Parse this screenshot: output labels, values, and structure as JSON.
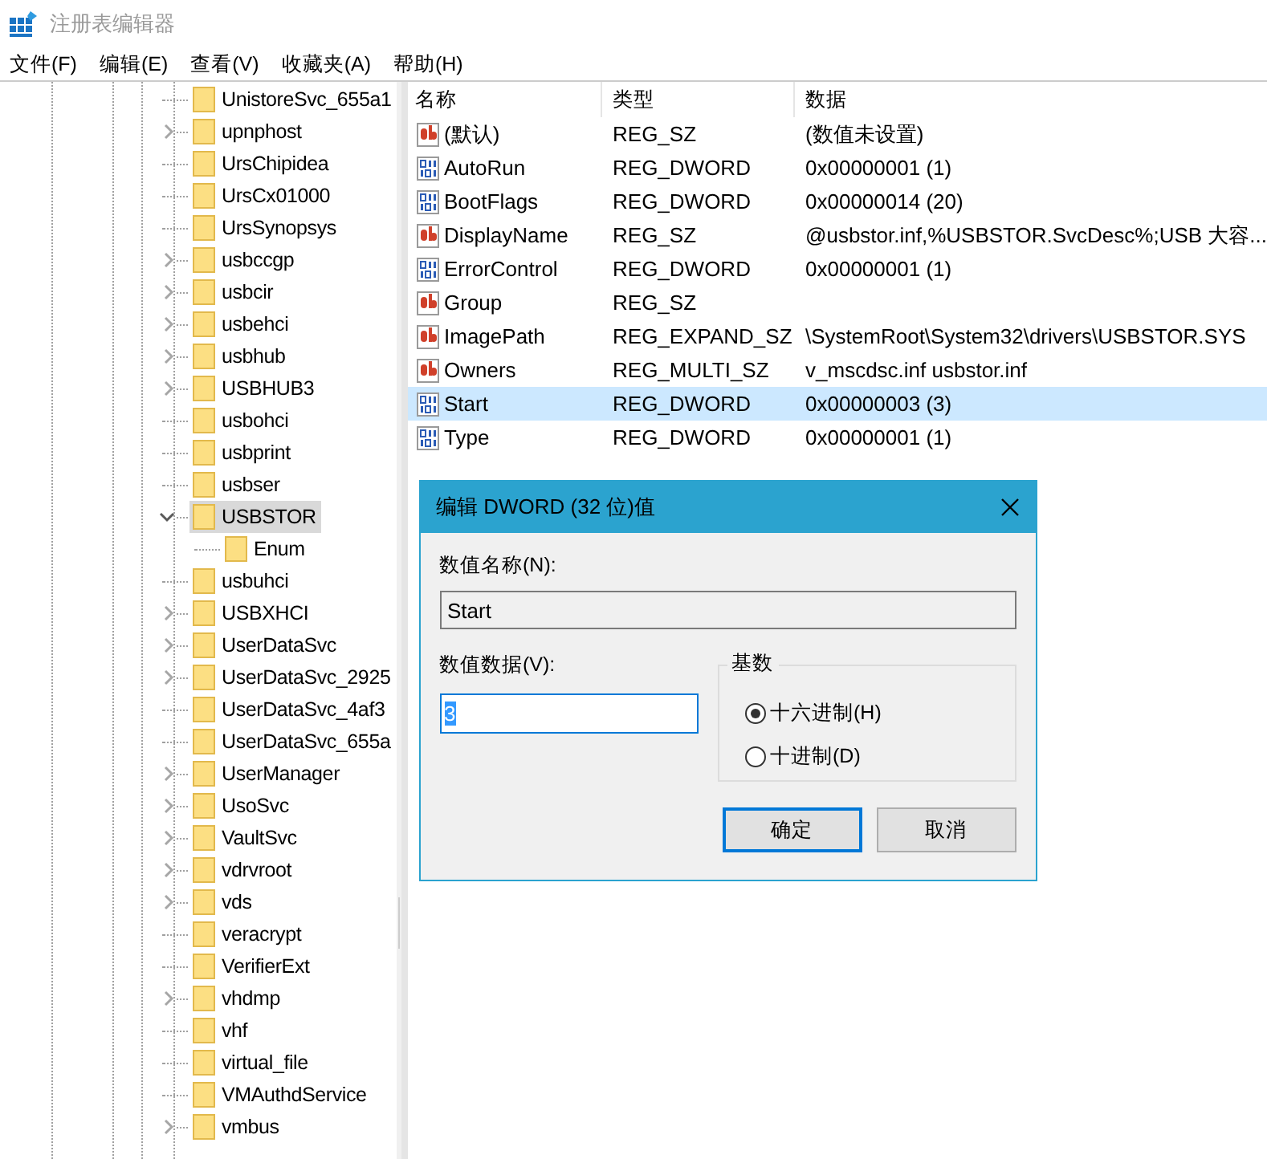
{
  "window": {
    "title": "注册表编辑器"
  },
  "menu": [
    "文件(F)",
    "编辑(E)",
    "查看(V)",
    "收藏夹(A)",
    "帮助(H)"
  ],
  "tree": {
    "items": [
      {
        "label": "UnistoreSvc_655a1",
        "kind": "leaf",
        "selected": false
      },
      {
        "label": "upnphost",
        "kind": "collapsed",
        "selected": false
      },
      {
        "label": "UrsChipidea",
        "kind": "leaf",
        "selected": false
      },
      {
        "label": "UrsCx01000",
        "kind": "leaf",
        "selected": false
      },
      {
        "label": "UrsSynopsys",
        "kind": "leaf",
        "selected": false
      },
      {
        "label": "usbccgp",
        "kind": "collapsed",
        "selected": false
      },
      {
        "label": "usbcir",
        "kind": "collapsed",
        "selected": false
      },
      {
        "label": "usbehci",
        "kind": "collapsed",
        "selected": false
      },
      {
        "label": "usbhub",
        "kind": "collapsed",
        "selected": false
      },
      {
        "label": "USBHUB3",
        "kind": "collapsed",
        "selected": false
      },
      {
        "label": "usbohci",
        "kind": "leaf",
        "selected": false
      },
      {
        "label": "usbprint",
        "kind": "leaf",
        "selected": false
      },
      {
        "label": "usbser",
        "kind": "leaf",
        "selected": false
      },
      {
        "label": "USBSTOR",
        "kind": "expanded",
        "selected": true,
        "children": [
          {
            "label": "Enum",
            "kind": "leaf",
            "selected": false
          }
        ]
      },
      {
        "label": "usbuhci",
        "kind": "leaf",
        "selected": false
      },
      {
        "label": "USBXHCI",
        "kind": "collapsed",
        "selected": false
      },
      {
        "label": "UserDataSvc",
        "kind": "collapsed",
        "selected": false
      },
      {
        "label": "UserDataSvc_2925",
        "kind": "collapsed",
        "selected": false
      },
      {
        "label": "UserDataSvc_4af3",
        "kind": "leaf",
        "selected": false
      },
      {
        "label": "UserDataSvc_655a",
        "kind": "leaf",
        "selected": false
      },
      {
        "label": "UserManager",
        "kind": "collapsed",
        "selected": false
      },
      {
        "label": "UsoSvc",
        "kind": "collapsed",
        "selected": false
      },
      {
        "label": "VaultSvc",
        "kind": "collapsed",
        "selected": false
      },
      {
        "label": "vdrvroot",
        "kind": "collapsed",
        "selected": false
      },
      {
        "label": "vds",
        "kind": "collapsed",
        "selected": false
      },
      {
        "label": "veracrypt",
        "kind": "leaf",
        "selected": false
      },
      {
        "label": "VerifierExt",
        "kind": "leaf",
        "selected": false
      },
      {
        "label": "vhdmp",
        "kind": "collapsed",
        "selected": false
      },
      {
        "label": "vhf",
        "kind": "leaf",
        "selected": false
      },
      {
        "label": "virtual_file",
        "kind": "leaf",
        "selected": false
      },
      {
        "label": "VMAuthdService",
        "kind": "leaf",
        "selected": false
      },
      {
        "label": "vmbus",
        "kind": "collapsed",
        "selected": false
      }
    ]
  },
  "values": {
    "columns": [
      "名称",
      "类型",
      "数据"
    ],
    "rows": [
      {
        "kind": "string",
        "name": "(默认)",
        "type": "REG_SZ",
        "data": "(数值未设置)",
        "selected": false
      },
      {
        "kind": "binary",
        "name": "AutoRun",
        "type": "REG_DWORD",
        "data": "0x00000001 (1)",
        "selected": false
      },
      {
        "kind": "binary",
        "name": "BootFlags",
        "type": "REG_DWORD",
        "data": "0x00000014 (20)",
        "selected": false
      },
      {
        "kind": "string",
        "name": "DisplayName",
        "type": "REG_SZ",
        "data": "@usbstor.inf,%USBSTOR.SvcDesc%;USB 大容...",
        "selected": false
      },
      {
        "kind": "binary",
        "name": "ErrorControl",
        "type": "REG_DWORD",
        "data": "0x00000001 (1)",
        "selected": false
      },
      {
        "kind": "string",
        "name": "Group",
        "type": "REG_SZ",
        "data": "",
        "selected": false
      },
      {
        "kind": "string",
        "name": "ImagePath",
        "type": "REG_EXPAND_SZ",
        "data": "\\SystemRoot\\System32\\drivers\\USBSTOR.SYS",
        "selected": false
      },
      {
        "kind": "string",
        "name": "Owners",
        "type": "REG_MULTI_SZ",
        "data": "v_mscdsc.inf usbstor.inf",
        "selected": false
      },
      {
        "kind": "binary",
        "name": "Start",
        "type": "REG_DWORD",
        "data": "0x00000003 (3)",
        "selected": true
      },
      {
        "kind": "binary",
        "name": "Type",
        "type": "REG_DWORD",
        "data": "0x00000001 (1)",
        "selected": false
      }
    ]
  },
  "dialog": {
    "title": "编辑 DWORD (32 位)值",
    "name_label": "数值名称(N):",
    "name_value": "Start",
    "data_label": "数值数据(V):",
    "data_value": "3",
    "base": {
      "title": "基数",
      "options": [
        {
          "label": "十六进制(H)",
          "selected": true
        },
        {
          "label": "十进制(D)",
          "selected": false
        }
      ]
    },
    "buttons": [
      {
        "label": "确定",
        "default": true
      },
      {
        "label": "取消",
        "default": false
      }
    ]
  }
}
